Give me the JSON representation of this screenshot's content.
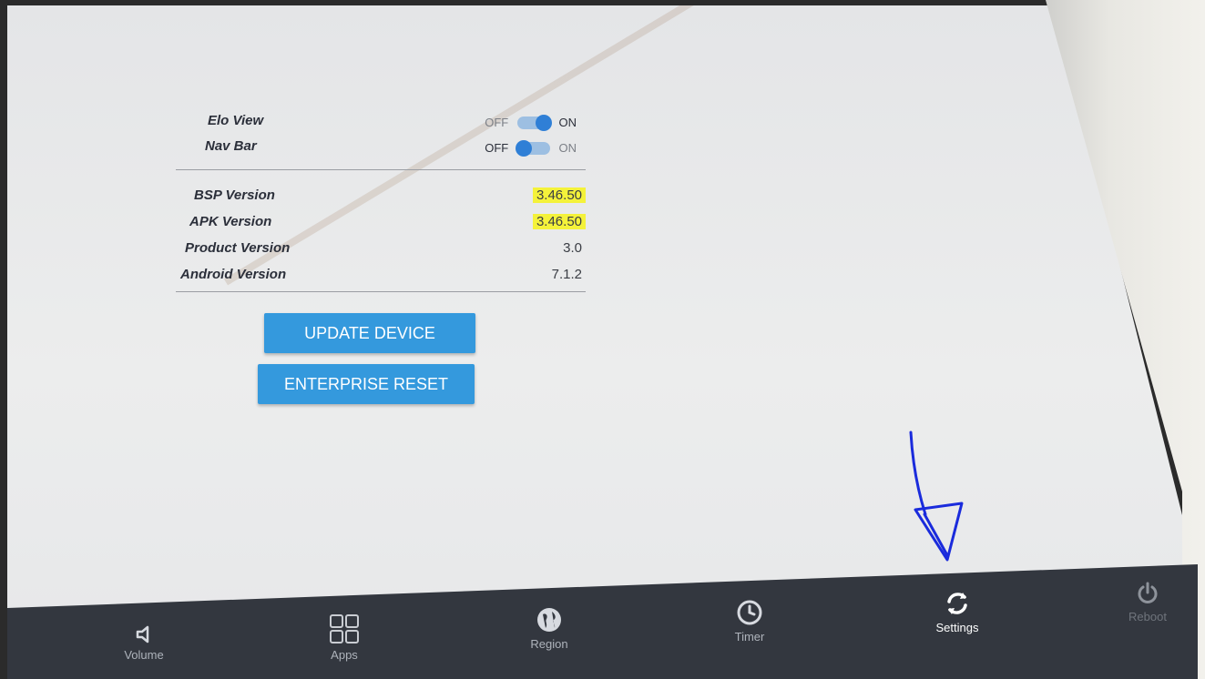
{
  "settings": {
    "elo_view": {
      "label": "Elo View",
      "off": "OFF",
      "on": "ON",
      "state": "on"
    },
    "nav_bar": {
      "label": "Nav Bar",
      "off": "OFF",
      "on": "ON",
      "state": "off"
    }
  },
  "versions": [
    {
      "label": "BSP Version",
      "value": "3.46.50",
      "highlighted": true
    },
    {
      "label": "APK Version",
      "value": "3.46.50",
      "highlighted": true
    },
    {
      "label": "Product Version",
      "value": "3.0",
      "highlighted": false
    },
    {
      "label": "Android Version",
      "value": "7.1.2",
      "highlighted": false
    }
  ],
  "buttons": {
    "update": "UPDATE DEVICE",
    "reset": "ENTERPRISE RESET"
  },
  "nav": [
    {
      "label": "Volume",
      "icon": "volume-icon"
    },
    {
      "label": "Apps",
      "icon": "apps-grid-icon"
    },
    {
      "label": "Region",
      "icon": "globe-icon"
    },
    {
      "label": "Timer",
      "icon": "clock-icon"
    },
    {
      "label": "Settings",
      "icon": "sync-icon",
      "active": true
    },
    {
      "label": "Reboot",
      "icon": "power-icon"
    }
  ],
  "colors": {
    "accent": "#3499dd",
    "highlight": "#f4f23a",
    "navbar": "#33373f",
    "annotation": "#1a2bdc"
  }
}
